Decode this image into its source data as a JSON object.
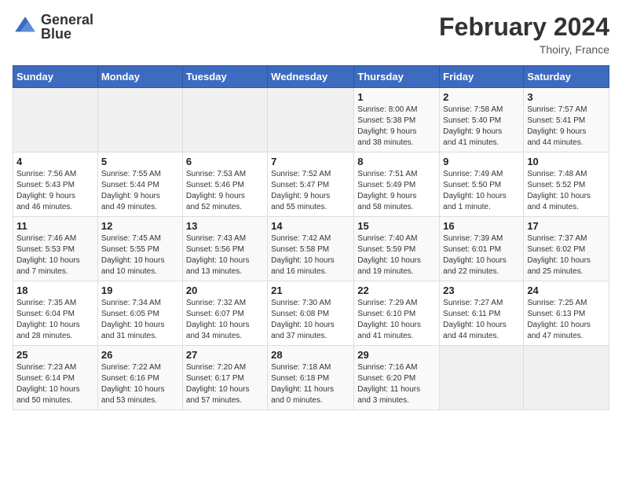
{
  "header": {
    "logo_line1": "General",
    "logo_line2": "Blue",
    "month": "February 2024",
    "location": "Thoiry, France"
  },
  "weekdays": [
    "Sunday",
    "Monday",
    "Tuesday",
    "Wednesday",
    "Thursday",
    "Friday",
    "Saturday"
  ],
  "weeks": [
    [
      {
        "num": "",
        "info": ""
      },
      {
        "num": "",
        "info": ""
      },
      {
        "num": "",
        "info": ""
      },
      {
        "num": "",
        "info": ""
      },
      {
        "num": "1",
        "info": "Sunrise: 8:00 AM\nSunset: 5:38 PM\nDaylight: 9 hours\nand 38 minutes."
      },
      {
        "num": "2",
        "info": "Sunrise: 7:58 AM\nSunset: 5:40 PM\nDaylight: 9 hours\nand 41 minutes."
      },
      {
        "num": "3",
        "info": "Sunrise: 7:57 AM\nSunset: 5:41 PM\nDaylight: 9 hours\nand 44 minutes."
      }
    ],
    [
      {
        "num": "4",
        "info": "Sunrise: 7:56 AM\nSunset: 5:43 PM\nDaylight: 9 hours\nand 46 minutes."
      },
      {
        "num": "5",
        "info": "Sunrise: 7:55 AM\nSunset: 5:44 PM\nDaylight: 9 hours\nand 49 minutes."
      },
      {
        "num": "6",
        "info": "Sunrise: 7:53 AM\nSunset: 5:46 PM\nDaylight: 9 hours\nand 52 minutes."
      },
      {
        "num": "7",
        "info": "Sunrise: 7:52 AM\nSunset: 5:47 PM\nDaylight: 9 hours\nand 55 minutes."
      },
      {
        "num": "8",
        "info": "Sunrise: 7:51 AM\nSunset: 5:49 PM\nDaylight: 9 hours\nand 58 minutes."
      },
      {
        "num": "9",
        "info": "Sunrise: 7:49 AM\nSunset: 5:50 PM\nDaylight: 10 hours\nand 1 minute."
      },
      {
        "num": "10",
        "info": "Sunrise: 7:48 AM\nSunset: 5:52 PM\nDaylight: 10 hours\nand 4 minutes."
      }
    ],
    [
      {
        "num": "11",
        "info": "Sunrise: 7:46 AM\nSunset: 5:53 PM\nDaylight: 10 hours\nand 7 minutes."
      },
      {
        "num": "12",
        "info": "Sunrise: 7:45 AM\nSunset: 5:55 PM\nDaylight: 10 hours\nand 10 minutes."
      },
      {
        "num": "13",
        "info": "Sunrise: 7:43 AM\nSunset: 5:56 PM\nDaylight: 10 hours\nand 13 minutes."
      },
      {
        "num": "14",
        "info": "Sunrise: 7:42 AM\nSunset: 5:58 PM\nDaylight: 10 hours\nand 16 minutes."
      },
      {
        "num": "15",
        "info": "Sunrise: 7:40 AM\nSunset: 5:59 PM\nDaylight: 10 hours\nand 19 minutes."
      },
      {
        "num": "16",
        "info": "Sunrise: 7:39 AM\nSunset: 6:01 PM\nDaylight: 10 hours\nand 22 minutes."
      },
      {
        "num": "17",
        "info": "Sunrise: 7:37 AM\nSunset: 6:02 PM\nDaylight: 10 hours\nand 25 minutes."
      }
    ],
    [
      {
        "num": "18",
        "info": "Sunrise: 7:35 AM\nSunset: 6:04 PM\nDaylight: 10 hours\nand 28 minutes."
      },
      {
        "num": "19",
        "info": "Sunrise: 7:34 AM\nSunset: 6:05 PM\nDaylight: 10 hours\nand 31 minutes."
      },
      {
        "num": "20",
        "info": "Sunrise: 7:32 AM\nSunset: 6:07 PM\nDaylight: 10 hours\nand 34 minutes."
      },
      {
        "num": "21",
        "info": "Sunrise: 7:30 AM\nSunset: 6:08 PM\nDaylight: 10 hours\nand 37 minutes."
      },
      {
        "num": "22",
        "info": "Sunrise: 7:29 AM\nSunset: 6:10 PM\nDaylight: 10 hours\nand 41 minutes."
      },
      {
        "num": "23",
        "info": "Sunrise: 7:27 AM\nSunset: 6:11 PM\nDaylight: 10 hours\nand 44 minutes."
      },
      {
        "num": "24",
        "info": "Sunrise: 7:25 AM\nSunset: 6:13 PM\nDaylight: 10 hours\nand 47 minutes."
      }
    ],
    [
      {
        "num": "25",
        "info": "Sunrise: 7:23 AM\nSunset: 6:14 PM\nDaylight: 10 hours\nand 50 minutes."
      },
      {
        "num": "26",
        "info": "Sunrise: 7:22 AM\nSunset: 6:16 PM\nDaylight: 10 hours\nand 53 minutes."
      },
      {
        "num": "27",
        "info": "Sunrise: 7:20 AM\nSunset: 6:17 PM\nDaylight: 10 hours\nand 57 minutes."
      },
      {
        "num": "28",
        "info": "Sunrise: 7:18 AM\nSunset: 6:18 PM\nDaylight: 11 hours\nand 0 minutes."
      },
      {
        "num": "29",
        "info": "Sunrise: 7:16 AM\nSunset: 6:20 PM\nDaylight: 11 hours\nand 3 minutes."
      },
      {
        "num": "",
        "info": ""
      },
      {
        "num": "",
        "info": ""
      }
    ]
  ]
}
